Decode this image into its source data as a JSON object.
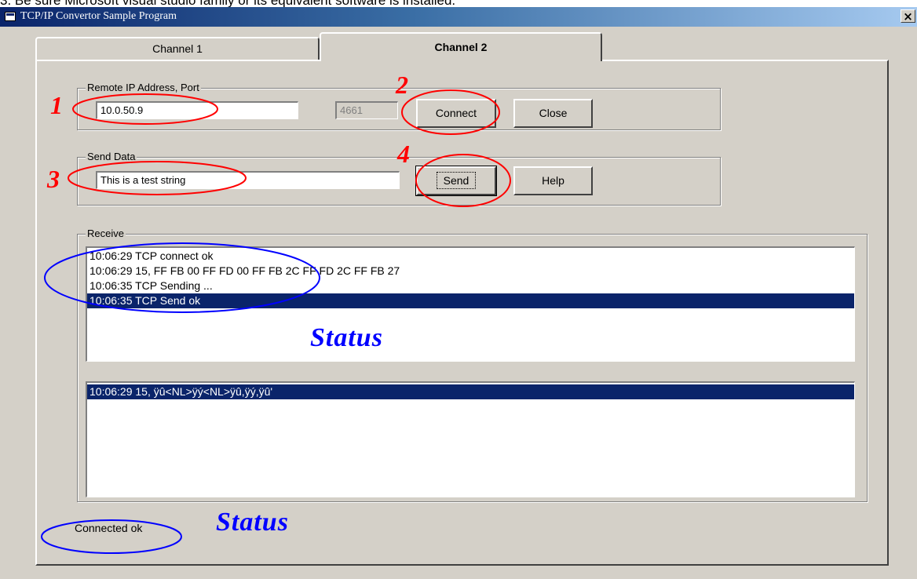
{
  "document": {
    "caption": "3. Be sure Microsoft visual studio family or its equivalent software is installed."
  },
  "window": {
    "title": "TCP/IP Convertor Sample Program",
    "close_glyph": "×"
  },
  "tabs": [
    {
      "label": "Channel 1",
      "selected": false
    },
    {
      "label": "Channel 2",
      "selected": true
    }
  ],
  "remote": {
    "group_label": "Remote IP Address, Port",
    "ip_value": "10.0.50.9",
    "port_value": "4661",
    "connect_label": "Connect",
    "close_label": "Close"
  },
  "send": {
    "group_label": "Send Data",
    "data_value": "This is a test string",
    "send_label": "Send",
    "help_label": "Help"
  },
  "receive": {
    "group_label": "Receive",
    "status_log": [
      "10:06:29 TCP connect ok",
      "10:06:29 15, FF FB 00 FF FD 00 FF FB 2C FF FD 2C FF FB 27",
      "10:06:35 TCP Sending ...",
      "10:06:35 TCP Send ok"
    ],
    "status_log_selected_index": 3,
    "data_log": [
      "10:06:29 15, ÿû<NL>ÿý<NL>ÿû,ÿý,ÿû'"
    ],
    "data_log_selected_index": 0
  },
  "status_bar": {
    "text": "Connected ok"
  },
  "annotations": {
    "step_1": "1",
    "step_2": "2",
    "step_3": "3",
    "step_4": "4",
    "status_label_1": "Status",
    "status_label_2": "Status",
    "step_color": "#ff0000",
    "status_color": "#0000ff"
  }
}
